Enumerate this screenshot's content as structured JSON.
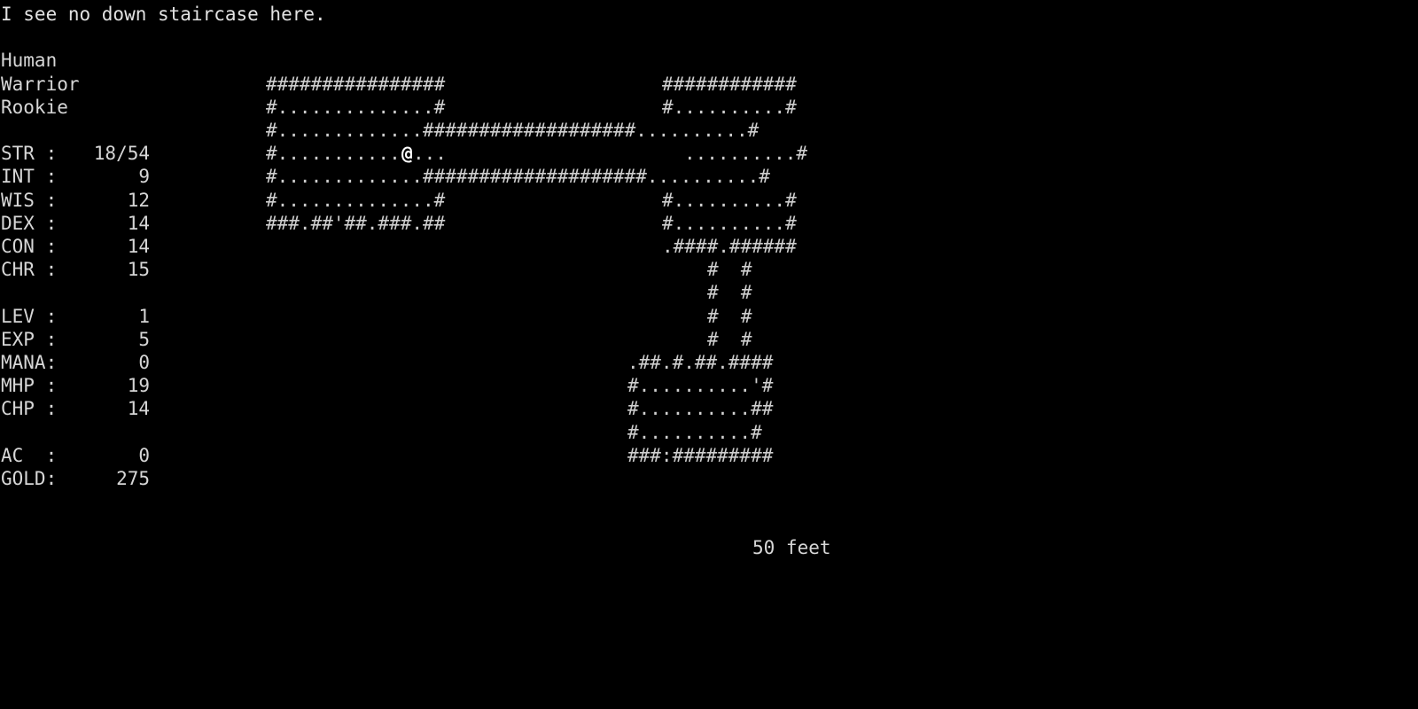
{
  "terminal": {
    "background_color": "#000000",
    "foreground_color": "#d6d6d6",
    "cols": 125,
    "rows": 30
  },
  "message": {
    "text": "I see no down staircase here."
  },
  "character": {
    "race": "Human",
    "class": "Warrior",
    "title": "Rookie"
  },
  "stats": {
    "attributes": [
      {
        "label": "STR :",
        "value": "18/54"
      },
      {
        "label": "INT :",
        "value": "9"
      },
      {
        "label": "WIS :",
        "value": "12"
      },
      {
        "label": "DEX :",
        "value": "14"
      },
      {
        "label": "CON :",
        "value": "14"
      },
      {
        "label": "CHR :",
        "value": "15"
      }
    ],
    "progress": [
      {
        "label": "LEV :",
        "value": "1"
      },
      {
        "label": "EXP :",
        "value": "5"
      },
      {
        "label": "MANA:",
        "value": "0"
      },
      {
        "label": "MHP :",
        "value": "19"
      },
      {
        "label": "CHP :",
        "value": "14"
      }
    ],
    "equipment": [
      {
        "label": "AC  :",
        "value": "0"
      },
      {
        "label": "GOLD:",
        "value": "275"
      }
    ]
  },
  "depth": {
    "text": "50 feet"
  },
  "player": {
    "glyph": "@",
    "row": 6,
    "col": 36
  },
  "map": {
    "legend": {
      "wall": "#",
      "floor": ".",
      "door_open": "'",
      "door_closed": ":",
      "player": "@"
    },
    "rows": [
      "                       ################            ############                                      ",
      "                       #..............#            #..........#                                      ",
      "                       #.............###################..........#                                 ",
      "                       #...........@...             ..........#                                      ",
      "                       #.............####################..........#                                 ",
      "                       #..............#            #..........#                                      ",
      "                       ###.##'##.###.##            #..........#                                      ",
      "                                                   .####.######                                      ",
      "                                                       #  #                                          ",
      "                                                       #  #                                          ",
      "                                                       #  #                                          ",
      "                                                       #  #                                          ",
      "                                                  .##.#.##.####                                      ",
      "                                                  #..........'#                                      ",
      "                                                  #..........##                                      ",
      "                                                  #..........#                                       ",
      "                                                  ###:#########                                      "
    ]
  },
  "map_lines": {
    "r3_left": "################",
    "r4_left": "#..............#",
    "r5_left": "#.............###################..........#",
    "r6_left_pre": "#...........",
    "r6_left_post": "...",
    "r6_right": "..........#",
    "r7_left": "#.............####################..........#",
    "r8_left": "#..............#",
    "r8_right": "#..........#",
    "r9_left": "###.##'##.###.##",
    "r9_right": "#..........#",
    "r3_right": "############",
    "r4_right": "#..........#",
    "r10_right": ".####.######",
    "r11_pipe": "#  #",
    "r15_room_top": ".##.#.##.####",
    "r16_room": "#..........'#",
    "r17_room": "#..........##",
    "r18_room": "#..........#",
    "r19_room": "###:#########"
  }
}
